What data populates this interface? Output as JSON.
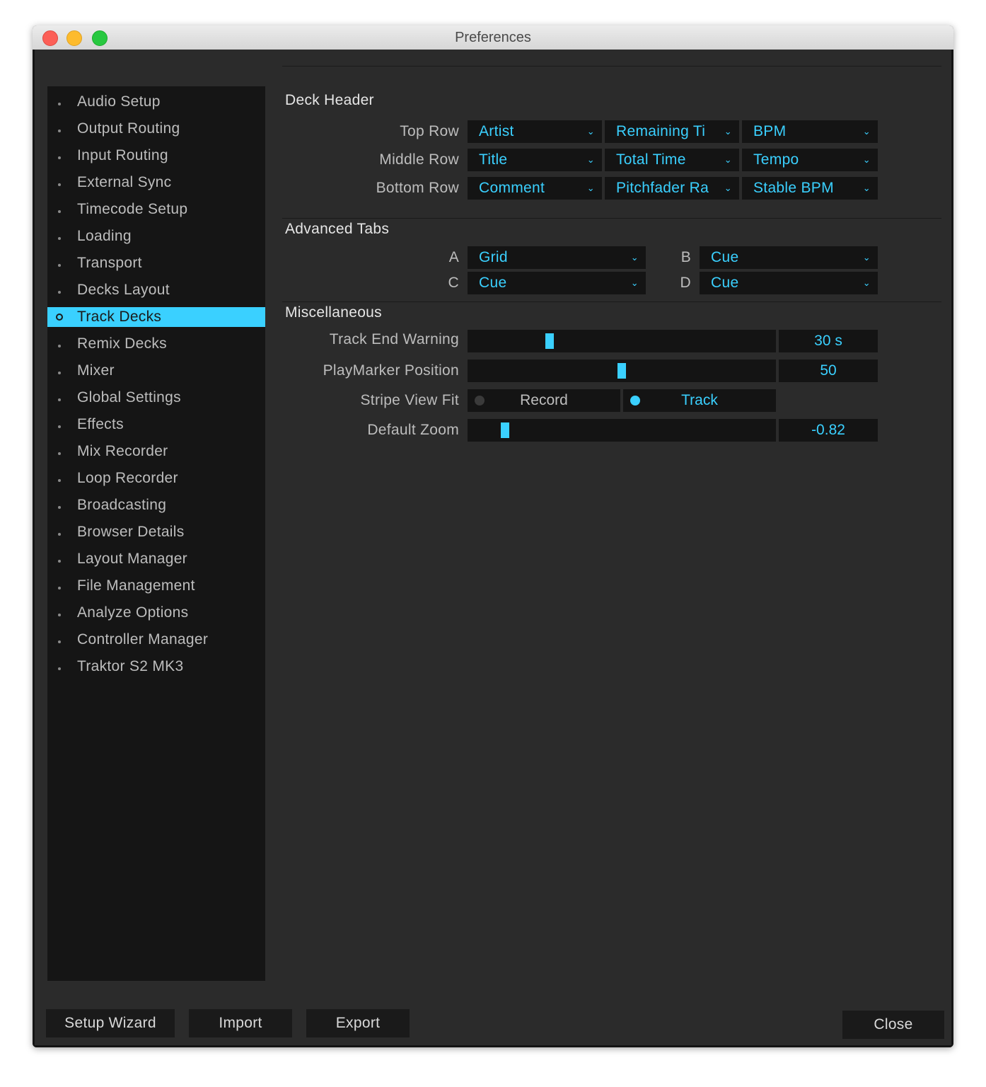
{
  "window": {
    "title": "Preferences"
  },
  "sidebar": {
    "items": [
      {
        "label": "Audio Setup",
        "active": false
      },
      {
        "label": "Output Routing",
        "active": false
      },
      {
        "label": "Input Routing",
        "active": false
      },
      {
        "label": "External Sync",
        "active": false
      },
      {
        "label": "Timecode Setup",
        "active": false
      },
      {
        "label": "Loading",
        "active": false
      },
      {
        "label": "Transport",
        "active": false
      },
      {
        "label": "Decks Layout",
        "active": false
      },
      {
        "label": "Track Decks",
        "active": true
      },
      {
        "label": "Remix Decks",
        "active": false
      },
      {
        "label": "Mixer",
        "active": false
      },
      {
        "label": "Global Settings",
        "active": false
      },
      {
        "label": "Effects",
        "active": false
      },
      {
        "label": "Mix Recorder",
        "active": false
      },
      {
        "label": "Loop Recorder",
        "active": false
      },
      {
        "label": "Broadcasting",
        "active": false
      },
      {
        "label": "Browser Details",
        "active": false
      },
      {
        "label": "Layout Manager",
        "active": false
      },
      {
        "label": "File Management",
        "active": false
      },
      {
        "label": "Analyze Options",
        "active": false
      },
      {
        "label": "Controller Manager",
        "active": false
      },
      {
        "label": "Traktor S2 MK3",
        "active": false
      }
    ]
  },
  "deck_header": {
    "title": "Deck Header",
    "rows": [
      {
        "label": "Top Row",
        "values": [
          "Artist",
          "Remaining Ti",
          "BPM"
        ]
      },
      {
        "label": "Middle Row",
        "values": [
          "Title",
          "Total Time",
          "Tempo"
        ]
      },
      {
        "label": "Bottom Row",
        "values": [
          "Comment",
          "Pitchfader Ra",
          "Stable BPM"
        ]
      }
    ]
  },
  "advanced_tabs": {
    "title": "Advanced Tabs",
    "a_label": "A",
    "a_value": "Grid",
    "b_label": "B",
    "b_value": "Cue",
    "c_label": "C",
    "c_value": "Cue",
    "d_label": "D",
    "d_value": "Cue"
  },
  "misc": {
    "title": "Miscellaneous",
    "track_end_warning": {
      "label": "Track End Warning",
      "value": "30 s",
      "level": 0.26
    },
    "playmarker_position": {
      "label": "PlayMarker Position",
      "value": "50",
      "level": 0.5
    },
    "stripe_view_fit": {
      "label": "Stripe View Fit",
      "option1": "Record",
      "option2": "Track",
      "selected": "Track"
    },
    "default_zoom": {
      "label": "Default Zoom",
      "value": "-0.82",
      "level": 0.11
    }
  },
  "footer": {
    "setup_wizard": "Setup Wizard",
    "import": "Import",
    "export": "Export",
    "close": "Close"
  },
  "colors": {
    "accent": "#3ad0ff",
    "panel": "#2b2b2b",
    "field": "#141414"
  },
  "icons": {
    "dropdown": "chevron-down-icon",
    "nav_bullet": "bullet-icon"
  }
}
